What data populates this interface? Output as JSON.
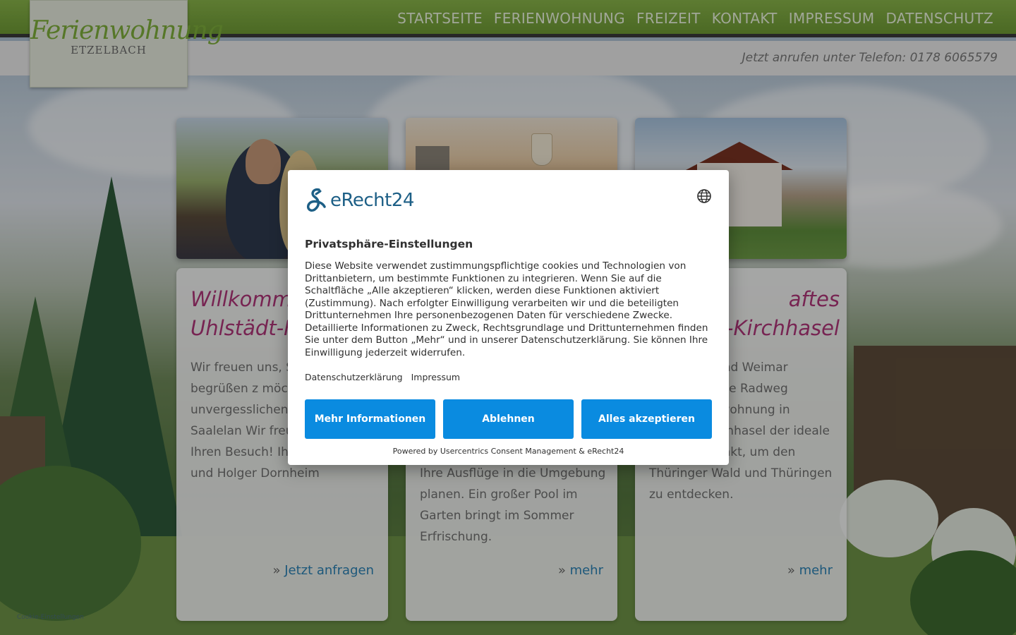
{
  "site": {
    "logo_title": "Ferienwohnung",
    "logo_subtitle": "Etzelbach",
    "nav": [
      "STARTSEITE",
      "FERIENWOHNUNG",
      "FREIZEIT",
      "KONTAKT",
      "IMPRESSUM",
      "DATENSCHUTZ"
    ],
    "phone": "Jetzt anrufen unter Telefon: 0178 6065579"
  },
  "cards": [
    {
      "heading_line1": "Willkommen",
      "heading_line2": "Uhlstädt-Ki",
      "text": "Wir freuen uns, S Gäste begrüßen z möchten Ihnen e unvergesslichen schönen Saalelan Wir freuen uns auf Ihren Besuch! Ihre Jacqueline und Holger Dornheim",
      "link_prefix": "»",
      "link_label": "Jetzt anfragen"
    },
    {
      "heading_line1": "",
      "heading_line2": "",
      "text": "Ihre Ausflüge in die Umgebung planen. Ein großer Pool im Garten bringt im Sommer Erfrischung.",
      "link_prefix": "»",
      "link_label": "mehr"
    },
    {
      "heading_line1": "aftes",
      "heading_line2": "-Kirchhasel",
      "text": "rischen na und Weimar ttelbarer Nähe Radweg gelegen, enwohnung in Uhlstädt-Kirchhasel der ideale Ausgangspunkt, um den Thüringer Wald und Thüringen zu entdecken.",
      "link_prefix": "»",
      "link_label": "mehr"
    }
  ],
  "consent": {
    "brand": "eRecht24",
    "title": "Privatsphäre-Einstellungen",
    "description": "Diese Website verwendet zustimmungspflichtige cookies und Technologien von Drittanbietern, um bestimmte Funktionen zu integrieren. Wenn Sie auf die Schaltfläche „Alle akzeptieren“ klicken, werden diese Funktionen aktiviert (Zustimmung). Nach erfolgter Einwilligung verarbeiten wir und die beteiligten Drittunternehmen Ihre personenbezogenen Daten für verschiedene Zwecke. Detaillierte Informationen zu Zweck, Rechtsgrundlage und Drittunternehmen finden Sie unter dem Button „Mehr“ und in unserer Datenschutzerklärung. Sie können Ihre Einwilligung jederzeit widerrufen.",
    "link_privacy": "Datenschutzerklärung",
    "link_imprint": "Impressum",
    "btn_more": "Mehr Informationen",
    "btn_reject": "Ablehnen",
    "btn_accept": "Alles akzeptieren",
    "powered": "Powered by Usercentrics Consent Management & eRecht24",
    "icon_globe": "globe-icon",
    "accent": "#0a8be0"
  },
  "footer": {
    "cookie_link": "Cookie-Einstellungen"
  }
}
